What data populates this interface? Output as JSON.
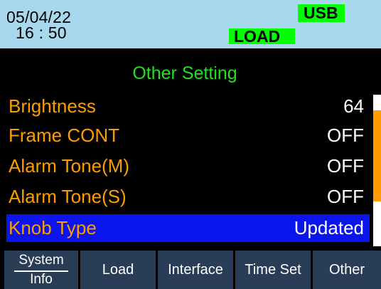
{
  "header": {
    "date": "05/04/22",
    "time": "16 : 50",
    "usb_badge": "USB",
    "load_badge": "LOAD",
    "colors": {
      "header_bg": "#a8d8ee",
      "badge_bg": "#00ff00"
    }
  },
  "page": {
    "title": "Other Setting",
    "colors": {
      "title": "#22e020",
      "label": "#ff9c00",
      "value": "#ffffff",
      "selected_row_bg": "#0a14ee"
    }
  },
  "settings": [
    {
      "label": "Brightness",
      "value": "64"
    },
    {
      "label": "Frame CONT",
      "value": "OFF"
    },
    {
      "label": "Alarm Tone(M)",
      "value": "OFF"
    },
    {
      "label": "Alarm Tone(S)",
      "value": "OFF"
    },
    {
      "label": "Knob Type",
      "value": "Updated",
      "selected": true
    }
  ],
  "tabs": [
    {
      "label_line1": "System",
      "label_line2": "Info"
    },
    {
      "label": "Load"
    },
    {
      "label": "Interface"
    },
    {
      "label": "Time Set"
    },
    {
      "label": "Other",
      "active": true
    }
  ]
}
